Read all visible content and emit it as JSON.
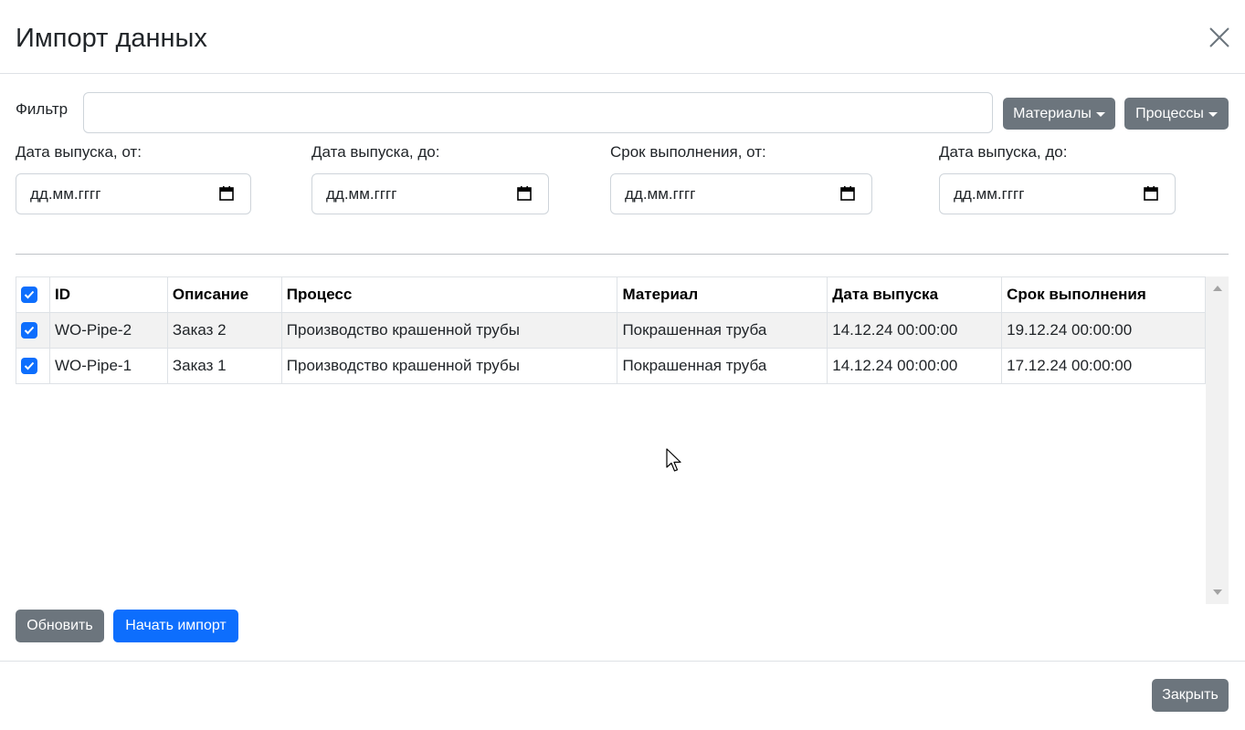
{
  "header": {
    "title": "Импорт данных",
    "close_icon": "close-icon"
  },
  "filter": {
    "label": "Фильтр",
    "value": "",
    "placeholder": "",
    "materials_button": "Материалы",
    "processes_button": "Процессы"
  },
  "dates": [
    {
      "label": "Дата выпуска, от:",
      "placeholder": "дд.мм.гггг"
    },
    {
      "label": "Дата выпуска, до:",
      "placeholder": "дд.мм.гггг"
    },
    {
      "label": "Срок выполнения, от:",
      "placeholder": "дд.мм.гггг"
    },
    {
      "label": "Дата выпуска, до:",
      "placeholder": "дд.мм.гггг"
    }
  ],
  "table": {
    "header_checked": true,
    "columns": [
      "ID",
      "Описание",
      "Процесс",
      "Материал",
      "Дата выпуска",
      "Срок выполнения"
    ],
    "rows": [
      {
        "checked": true,
        "id": "WO-Pipe-2",
        "description": "Заказ 2",
        "process": "Производство крашенной трубы",
        "material": "Покрашенная труба",
        "release_date": "14.12.24 00:00:00",
        "due_date": "19.12.24 00:00:00"
      },
      {
        "checked": true,
        "id": "WO-Pipe-1",
        "description": "Заказ 1",
        "process": "Производство крашенной трубы",
        "material": "Покрашенная труба",
        "release_date": "14.12.24 00:00:00",
        "due_date": "17.12.24 00:00:00"
      }
    ]
  },
  "actions": {
    "refresh": "Обновить",
    "start_import": "Начать импорт"
  },
  "footer": {
    "close": "Закрыть"
  },
  "colors": {
    "primary": "#0d6efd",
    "secondary": "#6c757d",
    "border": "#dee2e6",
    "stripe": "#f2f2f2"
  }
}
